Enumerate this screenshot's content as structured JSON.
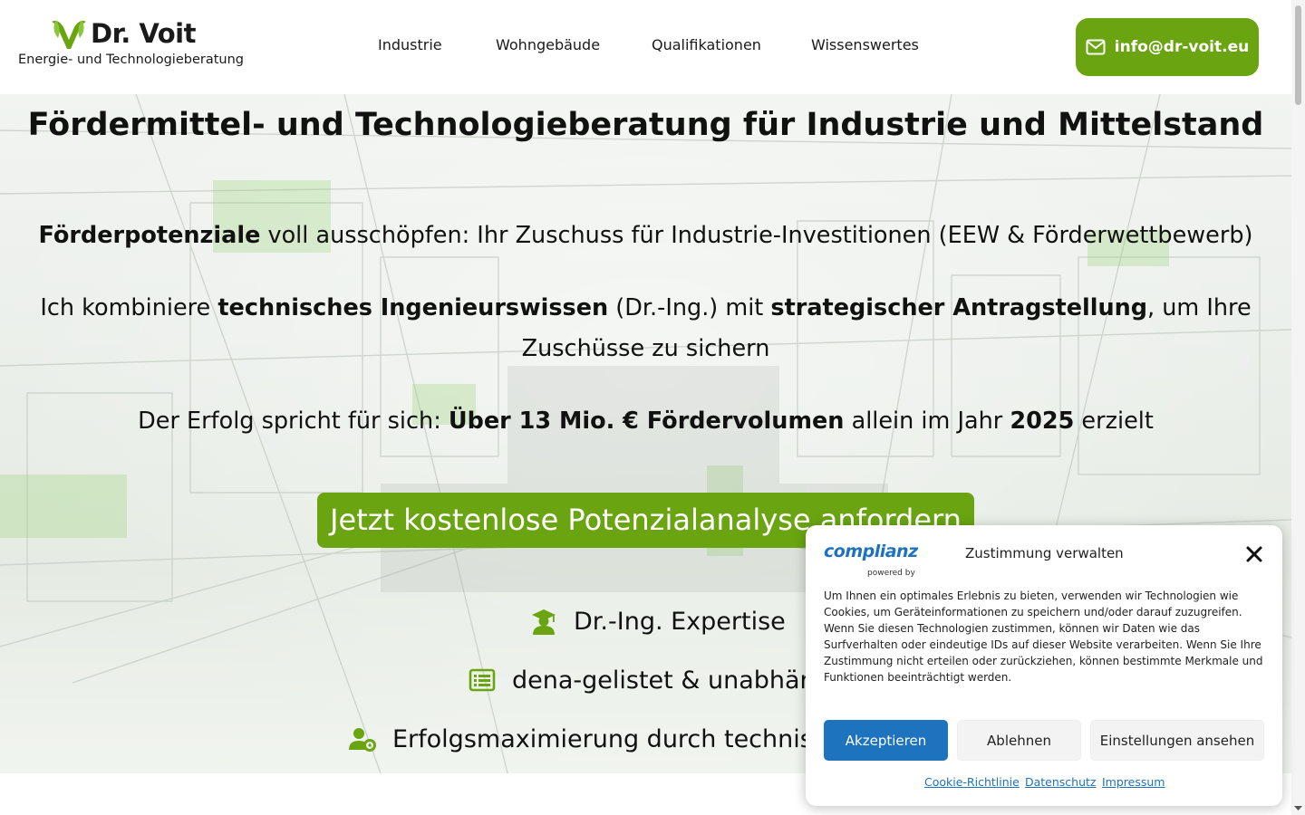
{
  "header": {
    "logo_name": "Dr. Voit",
    "logo_tagline": "Energie- und Technologieberatung",
    "nav": [
      {
        "label": "Industrie"
      },
      {
        "label": "Wohngebäude"
      },
      {
        "label": "Qualifikationen"
      },
      {
        "label": "Wissenswertes"
      }
    ],
    "email_label": "info@dr-voit.eu",
    "email_icon": "envelope-icon"
  },
  "hero": {
    "title": "Fördermittel- und Technologieberatung für Industrie und Mittelstand",
    "line1": {
      "bold": "Förderpotenziale",
      "rest": " voll ausschöpfen: Ihr Zuschuss für Industrie-Investitionen (EEW & Förderwettbewerb)"
    },
    "line2": {
      "t1": "Ich kombiniere ",
      "b1": "technisches Ingenieurswissen",
      "t2": " (Dr.-Ing.) mit ",
      "b2": "strategischer Antragstellung",
      "t3": ", um Ihre Zuschüsse zu sichern"
    },
    "line3": {
      "t1": "Der Erfolg spricht für sich: ",
      "b1": "Über 13 Mio. € Fördervolumen",
      "t2": " allein im Jahr ",
      "b2": "2025",
      "t3": " erzielt"
    },
    "cta_label": "Jetzt kostenlose Potenzialanalyse anfordern",
    "features": [
      {
        "label": "Dr.-Ing. Expertise",
        "icon": "graduate-icon"
      },
      {
        "label": "dena-gelistet & unabhängig",
        "icon": "list-icon"
      },
      {
        "label": "Erfolgsmaximierung durch technische Expertise",
        "icon": "user-cog-icon"
      }
    ]
  },
  "consent": {
    "brand": "complianz",
    "brand_sub": "powered by",
    "title": "Zustimmung verwalten",
    "text": "Um Ihnen ein optimales Erlebnis zu bieten, verwenden wir Technologien wie Cookies, um Geräteinformationen zu speichern und/oder darauf zuzugreifen. Wenn Sie diesen Technologien zustimmen, können wir Daten wie das Surfverhalten oder eindeutige IDs auf dieser Website verarbeiten. Wenn Sie Ihre Zustimmung nicht erteilen oder zurückziehen, können bestimmte Merkmale und Funktionen beeinträchtigt werden.",
    "accept_label": "Akzeptieren",
    "deny_label": "Ablehnen",
    "prefs_label": "Einstellungen ansehen",
    "links": [
      {
        "label": "Cookie-Richtlinie"
      },
      {
        "label": "Datenschutz"
      },
      {
        "label": "Impressum"
      }
    ]
  },
  "colors": {
    "brand_green": "#6aa511",
    "consent_blue": "#1e73be"
  }
}
